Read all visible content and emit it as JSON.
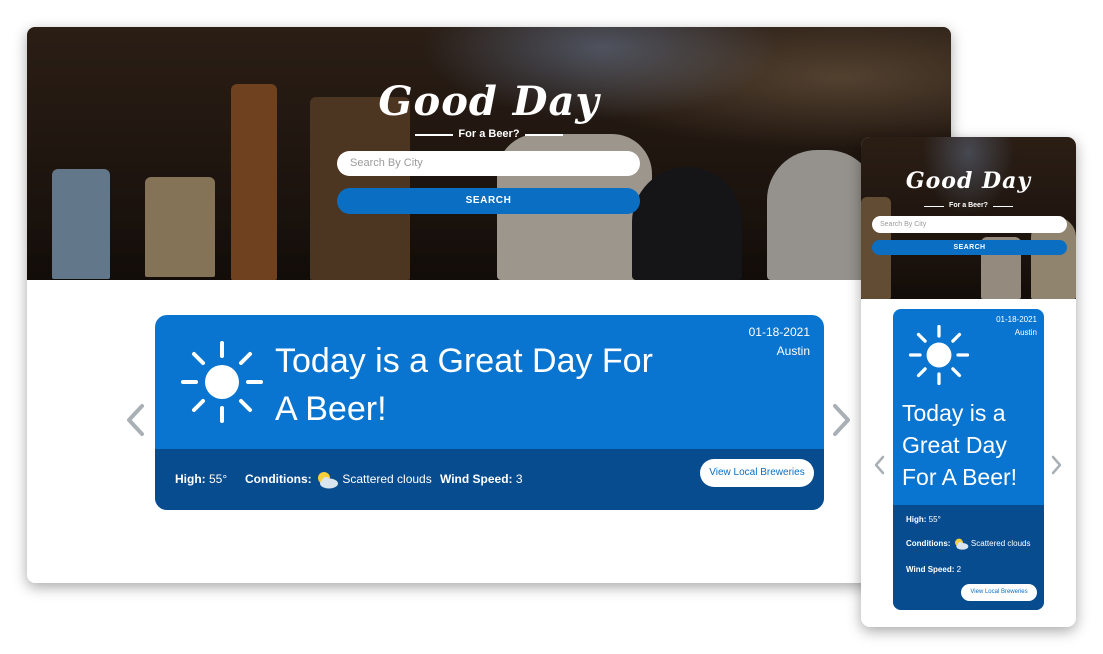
{
  "brand": {
    "title": "Good Day",
    "tagline": "For a Beer?"
  },
  "search": {
    "placeholder": "Search By City",
    "button_label": "SEARCH"
  },
  "forecast": {
    "date": "01-18-2021",
    "city": "Austin",
    "headline": "Today is a Great Day For A Beer!",
    "high_label": "High:",
    "high_value": "55°",
    "conditions_label": "Conditions:",
    "conditions_value": "Scattered clouds",
    "wind_label": "Wind Speed:",
    "wind_value": "3",
    "weather_icon": "sun-icon",
    "conditions_icon": "partly-cloudy-icon"
  },
  "mobile_forecast": {
    "wind_value": "2"
  },
  "actions": {
    "brew_button_label": "View Local Breweries"
  },
  "nav": {
    "prev_icon": "chevron-left-icon",
    "next_icon": "chevron-right-icon"
  },
  "colors": {
    "card": "#0a75d0",
    "card_footer": "#084c90",
    "button": "#0a6fc2",
    "chevron": "#a9b0b6"
  }
}
